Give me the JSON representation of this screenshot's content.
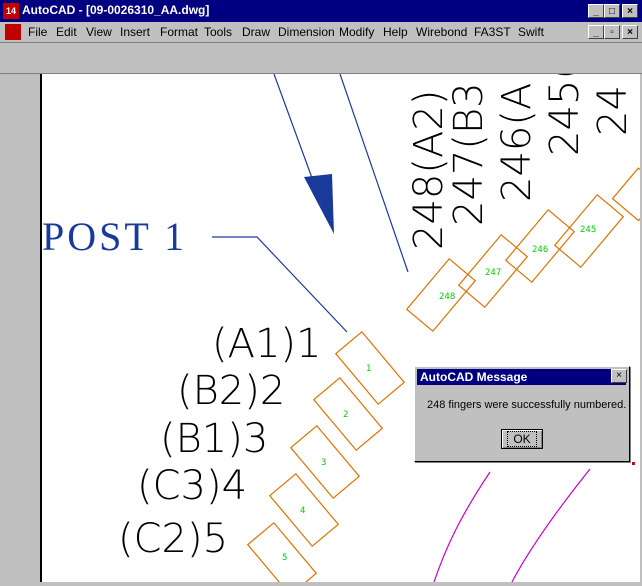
{
  "window": {
    "title": "AutoCAD - [09-0026310_AA.dwg]",
    "app_icon": "14",
    "buttons": [
      "minimize-icon",
      "restore-icon",
      "close-icon"
    ]
  },
  "menu": {
    "items": [
      "File",
      "Edit",
      "View",
      "Insert",
      "Format",
      "Tools",
      "Draw",
      "Dimension",
      "Modify",
      "Help",
      "Wirebond",
      "FA3ST",
      "Swift"
    ]
  },
  "drawing": {
    "post_label": "POST 1",
    "left_labels": [
      "(A1)1",
      "(B2)2",
      "(B1)3",
      "(C3)4",
      "(C2)5"
    ],
    "right_labels": [
      "248(A2)",
      "247(B3",
      "246(A",
      "245(",
      "24"
    ],
    "left_finger_numbers": [
      "1",
      "2",
      "3",
      "4",
      "5"
    ],
    "right_finger_numbers": [
      "248",
      "247",
      "246",
      "245"
    ],
    "colors": {
      "finger_outline": "#e07000",
      "finger_number": "#00cc00",
      "leader": "#1a3a9a",
      "magenta_line": "#cc00cc",
      "label_text": "#000000"
    }
  },
  "dialog": {
    "title": "AutoCAD Message",
    "message": "248 fingers were successfully numbered.",
    "ok_label": "OK"
  }
}
